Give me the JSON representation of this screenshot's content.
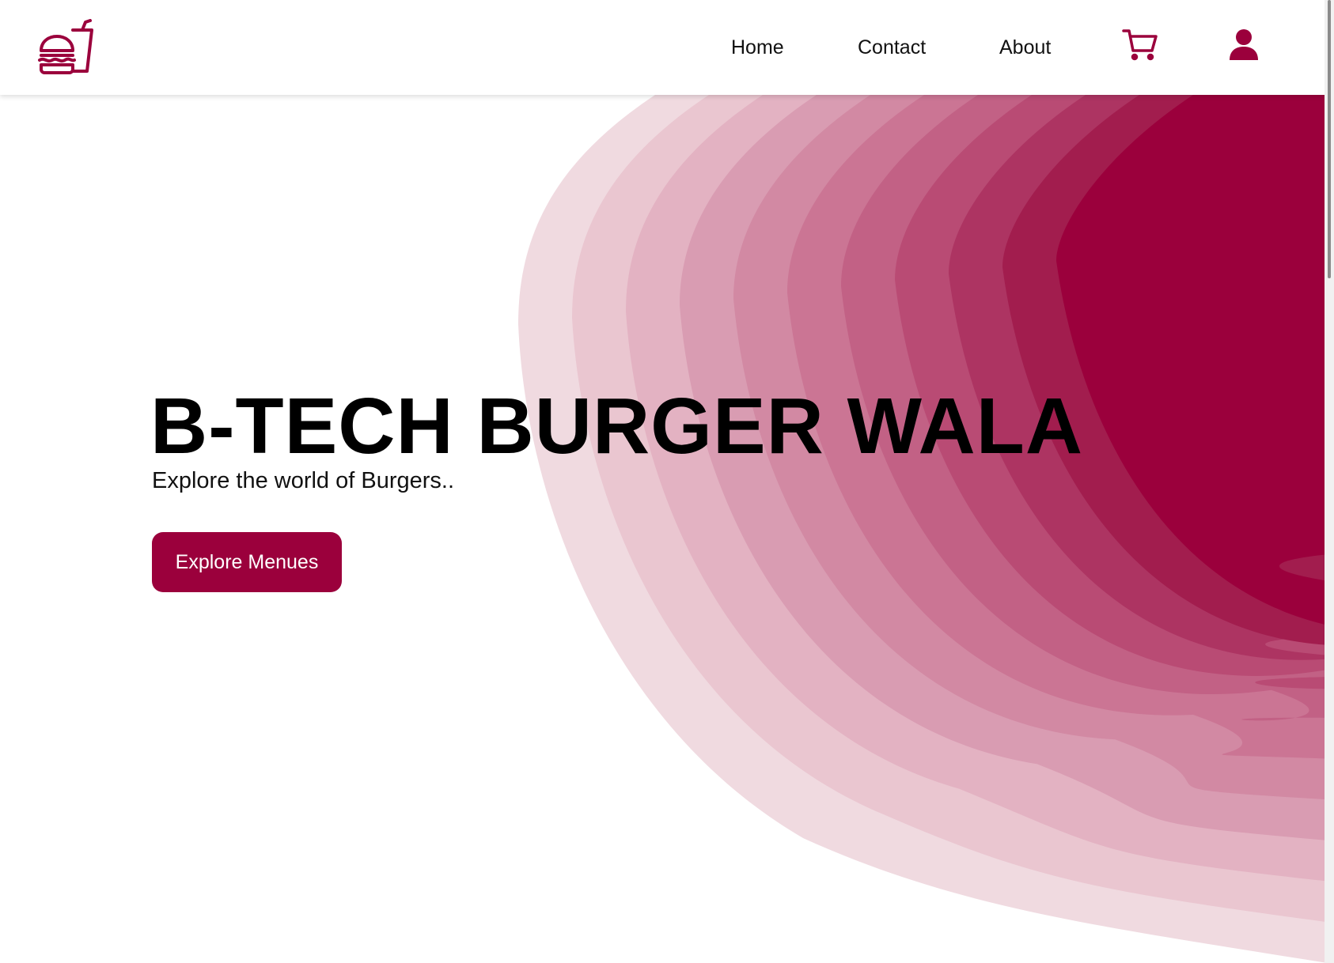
{
  "brand": {
    "logo_icon": "burger-and-drink-icon",
    "accent_color": "#9b003c"
  },
  "nav": {
    "links": [
      {
        "label": "Home"
      },
      {
        "label": "Contact"
      },
      {
        "label": "About"
      }
    ],
    "cart_icon": "shopping-cart-icon",
    "user_icon": "user-icon"
  },
  "hero": {
    "title": "B-TECH BURGER WALA",
    "subtitle": "Explore the world of Burgers..",
    "cta_label": "Explore Menues",
    "wave_colors": [
      "#f0dae0",
      "#eac6d0",
      "#e3b2c2",
      "#d99cb2",
      "#d289a3",
      "#cb7594",
      "#c26185",
      "#b94b74",
      "#ad3462",
      "#a21d4e",
      "#9b003c"
    ]
  }
}
